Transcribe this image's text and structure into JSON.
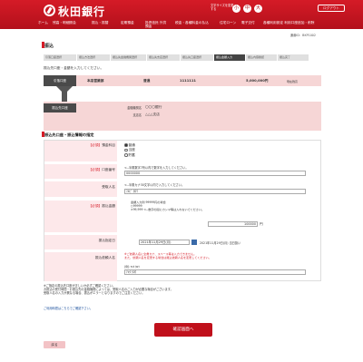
{
  "header": {
    "logo": "秋田銀行",
    "fontsize_label": "文字サイズを変更する",
    "fontsize_small": "小",
    "fontsize_medium": "中",
    "fontsize_large": "大",
    "logout": "ログアウト"
  },
  "nav": {
    "items": [
      "ホーム",
      "残高・明細照会",
      "振込・振替",
      "定期預金",
      "投資信託 外貨預金",
      "税金・各種料金の払込",
      "住宅ローン",
      "電子交付",
      "各種利用設定 利用口座追加・削除"
    ]
  },
  "date": "通番ID：BKP1002",
  "page_title": "振込",
  "steps": [
    "引落口座選択",
    "振込方法選択",
    "振込先金融機関選択",
    "振込先支店選択",
    "振込先口座選択",
    "振込金額入力",
    "振込内容確認",
    "振込完了"
  ],
  "active_step": 5,
  "instruction": "振込先口座・金額を入力してください。",
  "from": {
    "label": "引落口座",
    "branch": "本店営業部",
    "type": "普通",
    "number": "1111111",
    "balance": "5,000,000円",
    "balance_label": "現在残高"
  },
  "to": {
    "label": "振込先口座",
    "bank_label": "金融機関名",
    "bank": "〇〇〇銀行",
    "branch_label": "支店名",
    "branch": "△△△支店"
  },
  "section_title": "振込先口座・振込情報の指定",
  "form": {
    "required": "【必須】",
    "subject_label": "預金科目",
    "subjects": [
      "普通",
      "当座",
      "貯蓄"
    ],
    "account_label": "口座番号",
    "account_hint": "<--半角数字7桁以内で数字を入力してください。",
    "account_value": "0000000",
    "payee_label": "受取人名",
    "payee_hint": "<--半角カナ30文字以内で入力してください。",
    "payee_value": "ﾏﾙﾋﾞ ﾀﾛｳ",
    "amount_label": "振込金額",
    "amount_note": "金額入力例 99999円の場合\n○99999\n×99,999 <--数字の間にカンマ等は入れないでください。",
    "amount_value": "100000",
    "amount_unit": "円",
    "date_label": "振込指定日",
    "date_value": "2021年11月29日(月)",
    "date_note": "2021年11月29日(月) 当日扱い",
    "client_label": "振込依頼人名",
    "client_note": "※ご依頼人名に全角カナ、スペース等は入力できません。\nまた、依頼人名を変更する場合は振込依頼人名を変更してください。",
    "client_sub_label": "(例) ｱｷﾀ ﾀﾛｳ",
    "client_value": "ｱｷﾀ ﾀﾛｳ"
  },
  "notes": "※ご指定の振込先口座が正しいか必ずご確認ください。\nお振込の受付時間・お振込先の金融機関によっては、受取人名のご入力が必要な場合がございます。\n受取人名の入力が異なる場合、振込がエラーとなりますのでご注意ください。",
  "help_text": "ご利用時間はこちらでご確認下さい。",
  "confirm": "確認画面へ",
  "back": "戻る"
}
